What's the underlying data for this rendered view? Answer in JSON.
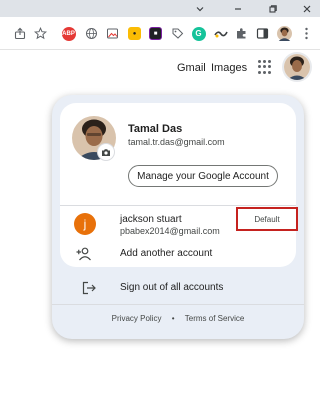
{
  "header": {
    "gmail_label": "Gmail",
    "images_label": "Images"
  },
  "extensions": [
    "ABP",
    "globe-icon",
    "photo-icon",
    "bulb-icon",
    "dark-reader-icon",
    "tag-icon",
    "grammarly-icon",
    "ext-icon",
    "puzzle-icon",
    "sidebar-icon",
    "profile-icon"
  ],
  "account": {
    "name": "Tamal Das",
    "email": "tamal.tr.das@gmail.com",
    "manage_label": "Manage your Google Account"
  },
  "other_account": {
    "initial": "j",
    "name": "jackson stuart",
    "email": "pbabex2014@gmail.com",
    "badge": "Default"
  },
  "actions": {
    "add_account": "Add another account",
    "sign_out": "Sign out of all accounts"
  },
  "footer": {
    "privacy": "Privacy Policy",
    "separator": "•",
    "terms": "Terms of Service"
  },
  "colors": {
    "card_bg": "#e9eef6",
    "badge_border": "#c5221f",
    "avatar_orange": "#e8710a"
  }
}
